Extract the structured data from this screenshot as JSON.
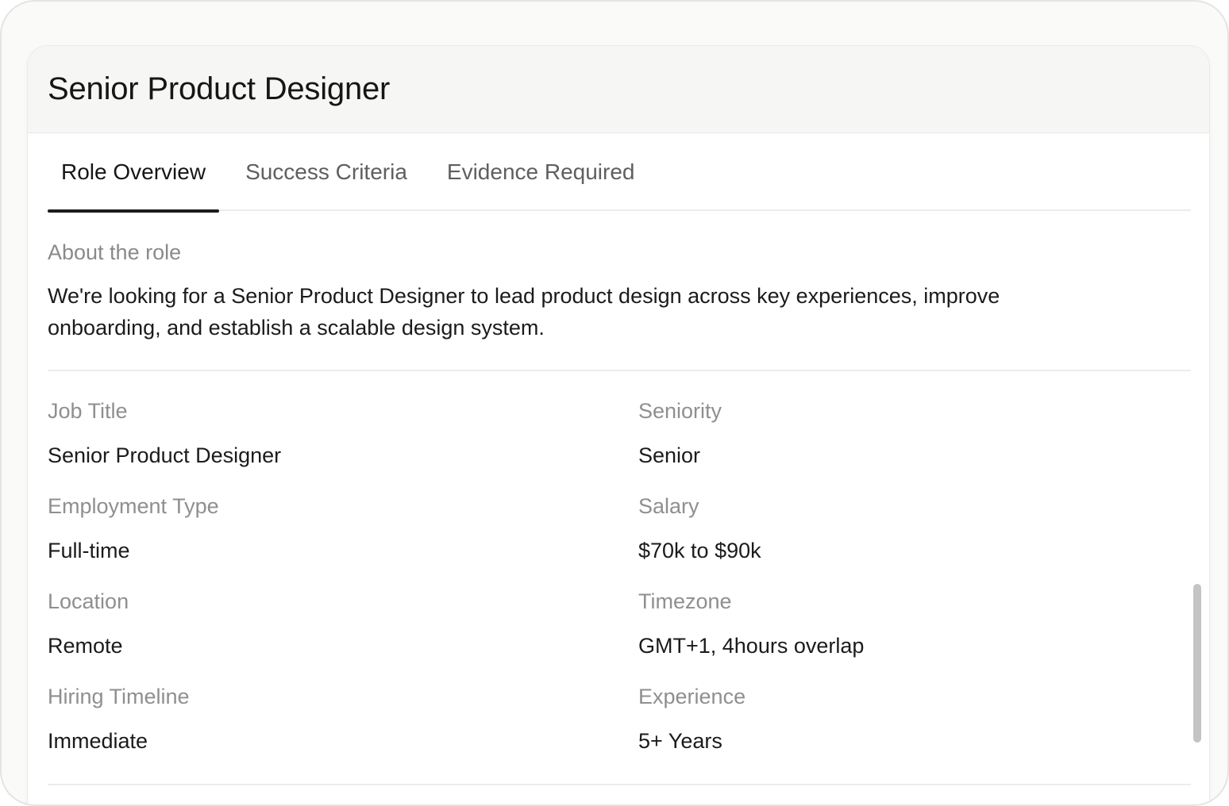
{
  "header": {
    "title": "Senior Product Designer"
  },
  "tabs": [
    {
      "label": "Role Overview",
      "active": true
    },
    {
      "label": "Success Criteria",
      "active": false
    },
    {
      "label": "Evidence Required",
      "active": false
    }
  ],
  "about": {
    "label": "About the role",
    "text": "We're looking for a Senior Product Designer to lead product design across key experiences, improve onboarding, and establish a scalable design system."
  },
  "fields": [
    {
      "label": "Job Title",
      "value": "Senior Product Designer"
    },
    {
      "label": "Seniority",
      "value": "Senior"
    },
    {
      "label": "Employment Type",
      "value": "Full-time"
    },
    {
      "label": "Salary",
      "value": "$70k to $90k"
    },
    {
      "label": "Location",
      "value": "Remote"
    },
    {
      "label": "Timezone",
      "value": "GMT+1, 4hours overlap"
    },
    {
      "label": "Hiring Timeline",
      "value": "Immediate"
    },
    {
      "label": "Experience",
      "value": "5+ Years"
    }
  ]
}
